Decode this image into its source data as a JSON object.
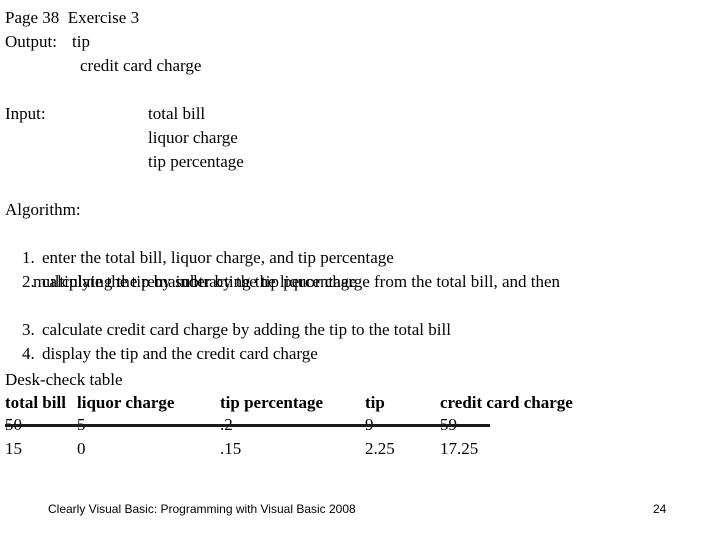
{
  "header": {
    "page_ref": "Page 38  Exercise 3",
    "output_label": "Output:",
    "output_items": [
      "tip",
      "credit card charge"
    ]
  },
  "input": {
    "label": "Input:",
    "items": [
      "total bill",
      "liquor charge",
      "tip percentage"
    ]
  },
  "algorithm": {
    "title": "Algorithm:",
    "steps": [
      {
        "num": "1.",
        "text": "enter the total bill, liquor charge, and tip percentage",
        "cont": ""
      },
      {
        "num": "2.",
        "text": "calculate the tip by subtracting the liquor charge from the total bill, and then",
        "cont": "multiplying the remainder by the tip percentage"
      },
      {
        "num": "3.",
        "text": "calculate credit card charge by adding the tip to the total bill",
        "cont": ""
      },
      {
        "num": "4.",
        "text": "display the tip and the credit card charge",
        "cont": ""
      }
    ]
  },
  "desk_check": {
    "title": "Desk-check table",
    "columns": [
      "total bill",
      "liquor charge",
      "tip percentage",
      "tip",
      "credit card charge"
    ],
    "rows": [
      {
        "values": [
          "50",
          "5",
          ".2",
          "9",
          "59"
        ],
        "struck": true
      },
      {
        "values": [
          "15",
          "0",
          ".15",
          "2.25",
          "17.25"
        ],
        "struck": false
      }
    ]
  },
  "footer": {
    "source": "Clearly Visual Basic: Programming with Visual Basic 2008",
    "page_number": "24"
  },
  "colors": {
    "text": "#000000",
    "background": "#ffffff",
    "strikethrough": "#1a1a1a"
  }
}
